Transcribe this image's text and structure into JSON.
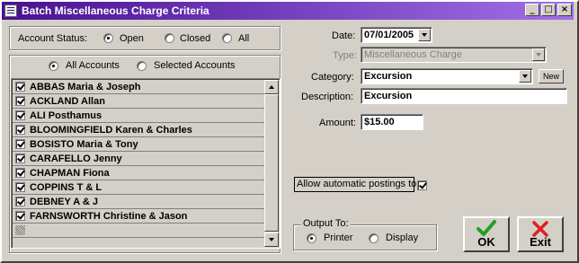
{
  "window": {
    "title": "Batch Miscellaneous Charge Criteria"
  },
  "titlebar_buttons": {
    "minimize": "_",
    "maximize": "□",
    "close": "×"
  },
  "account_status": {
    "label": "Account Status:",
    "options": [
      "Open",
      "Closed",
      "All"
    ],
    "selected": "Open"
  },
  "accounts_scope": {
    "options": [
      "All Accounts",
      "Selected Accounts"
    ],
    "selected": "All Accounts"
  },
  "accounts": [
    {
      "name": "ABBAS Maria & Joseph",
      "checked": true
    },
    {
      "name": "ACKLAND Allan",
      "checked": true
    },
    {
      "name": "ALI Posthamus",
      "checked": true
    },
    {
      "name": "BLOOMINGFIELD Karen & Charles",
      "checked": true
    },
    {
      "name": "BOSISTO Maria & Tony",
      "checked": true
    },
    {
      "name": "CARAFELLO Jenny",
      "checked": true
    },
    {
      "name": "CHAPMAN Fiona",
      "checked": true
    },
    {
      "name": "COPPINS T & L",
      "checked": true
    },
    {
      "name": "DEBNEY A & J",
      "checked": true
    },
    {
      "name": "FARNSWORTH Christine & Jason",
      "checked": true
    }
  ],
  "form": {
    "date_label": "Date:",
    "date_value": "07/01/2005",
    "type_label": "Type:",
    "type_value": "Miscellaneous Charge",
    "category_label": "Category:",
    "category_value": "Excursion",
    "new_label": "New",
    "description_label": "Description:",
    "description_value": "Excursion",
    "amount_label": "Amount:",
    "amount_value": "$15.00",
    "auto_post_label": "Allow automatic postings to",
    "auto_post_checked": true
  },
  "output": {
    "label": "Output To:",
    "options": [
      "Printer",
      "Display"
    ],
    "selected": "Printer"
  },
  "buttons": {
    "ok_label": "OK",
    "exit_label": "Exit"
  }
}
